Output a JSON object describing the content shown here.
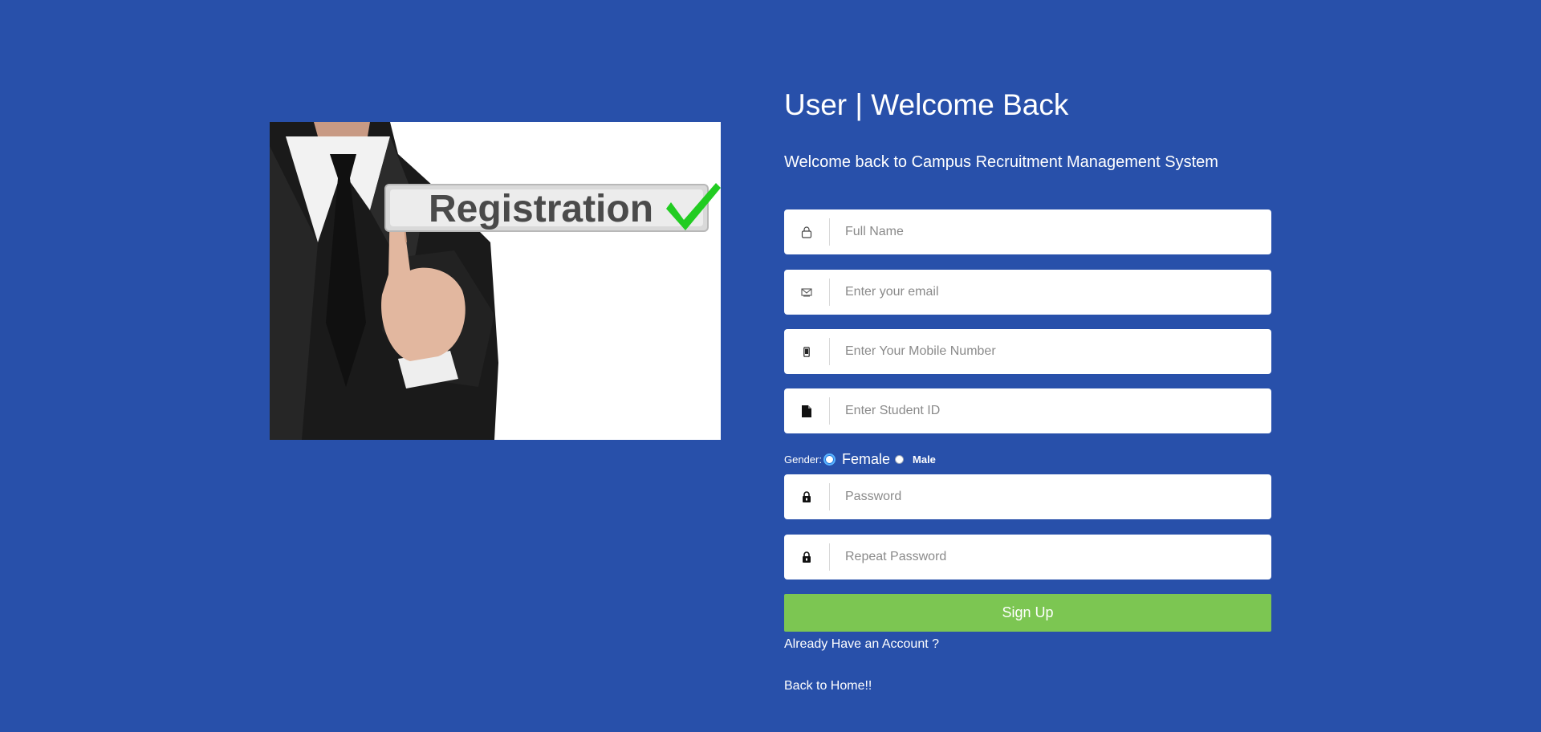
{
  "hero": {
    "image_text": "Registration"
  },
  "header": {
    "title": "User | Welcome Back",
    "subtitle": "Welcome back to Campus Recruitment Management System"
  },
  "form": {
    "fields": [
      {
        "icon": "user-icon",
        "placeholder": "Full Name",
        "value": ""
      },
      {
        "icon": "email-icon",
        "placeholder": "Enter your email",
        "value": ""
      },
      {
        "icon": "mobile-icon",
        "placeholder": "Enter Your Mobile Number",
        "value": ""
      },
      {
        "icon": "document-icon",
        "placeholder": "Enter Student ID",
        "value": ""
      },
      {
        "icon": "lock-icon",
        "placeholder": "Password",
        "value": ""
      },
      {
        "icon": "lock-icon",
        "placeholder": "Repeat Password",
        "value": ""
      }
    ],
    "gender": {
      "label": "Gender:",
      "options": [
        "Female",
        "Male"
      ],
      "selected": ""
    },
    "submit_label": "Sign Up",
    "login_link": "Already Have an Account ?",
    "home_link": "Back to Home!!"
  },
  "colors": {
    "background": "#2850aa",
    "submit": "#7cc652",
    "check": "#22cc22"
  }
}
